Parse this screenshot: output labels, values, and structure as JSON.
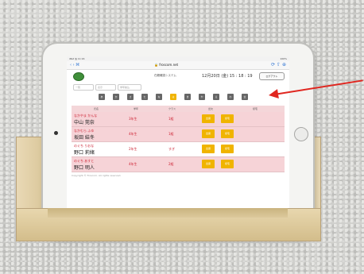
{
  "screen": {
    "status_left": "iPad ᯾ 11:16",
    "status_right": "100%",
    "nav_buttons": "‹  ›  ⌘",
    "url": "🔒 froscom.net",
    "tools": "⟳ ⇧ ⊕",
    "app_title": "在籍確認システム",
    "datetime": "12月20日 (金)  15 : 18 : 19",
    "logout": "ログアウト",
    "select_1": "一覧",
    "select_2": "表示",
    "select_3": "学年絞込",
    "letters": [
      "あ",
      "か",
      "さ",
      "た",
      "な",
      "は",
      "ま",
      "や",
      "ら",
      "わ",
      "全"
    ],
    "active_letter_index": 5,
    "headers": [
      "氏名",
      "学年",
      "クラス",
      "出欠",
      "帰宅"
    ],
    "rows": [
      {
        "kana": "なかやま かんな",
        "kanji": "中山 莞奈",
        "grade": "3年生",
        "class": "1組",
        "btn1": "出席",
        "btn2": "帰宅"
      },
      {
        "kana": "なかむら ふゆ",
        "kanji": "坂田 結冬",
        "grade": "4年生",
        "class": "1組",
        "btn1": "出席",
        "btn2": "帰宅"
      },
      {
        "kana": "のぐち りおな",
        "kanji": "野口 莉緒",
        "grade": "2年生",
        "class": "すぎ",
        "btn1": "出席",
        "btn2": "帰宅"
      },
      {
        "kana": "のぐち あすと",
        "kanji": "野口 明人",
        "grade": "4年生",
        "class": "2組",
        "btn1": "出席",
        "btn2": "帰宅"
      }
    ],
    "footer": "Copyright © Froscom. All rights reserved."
  },
  "colors": {
    "accent_button": "#f0b400",
    "row_pink": "#f6d3d7",
    "annotation_arrow": "#e0261f"
  }
}
